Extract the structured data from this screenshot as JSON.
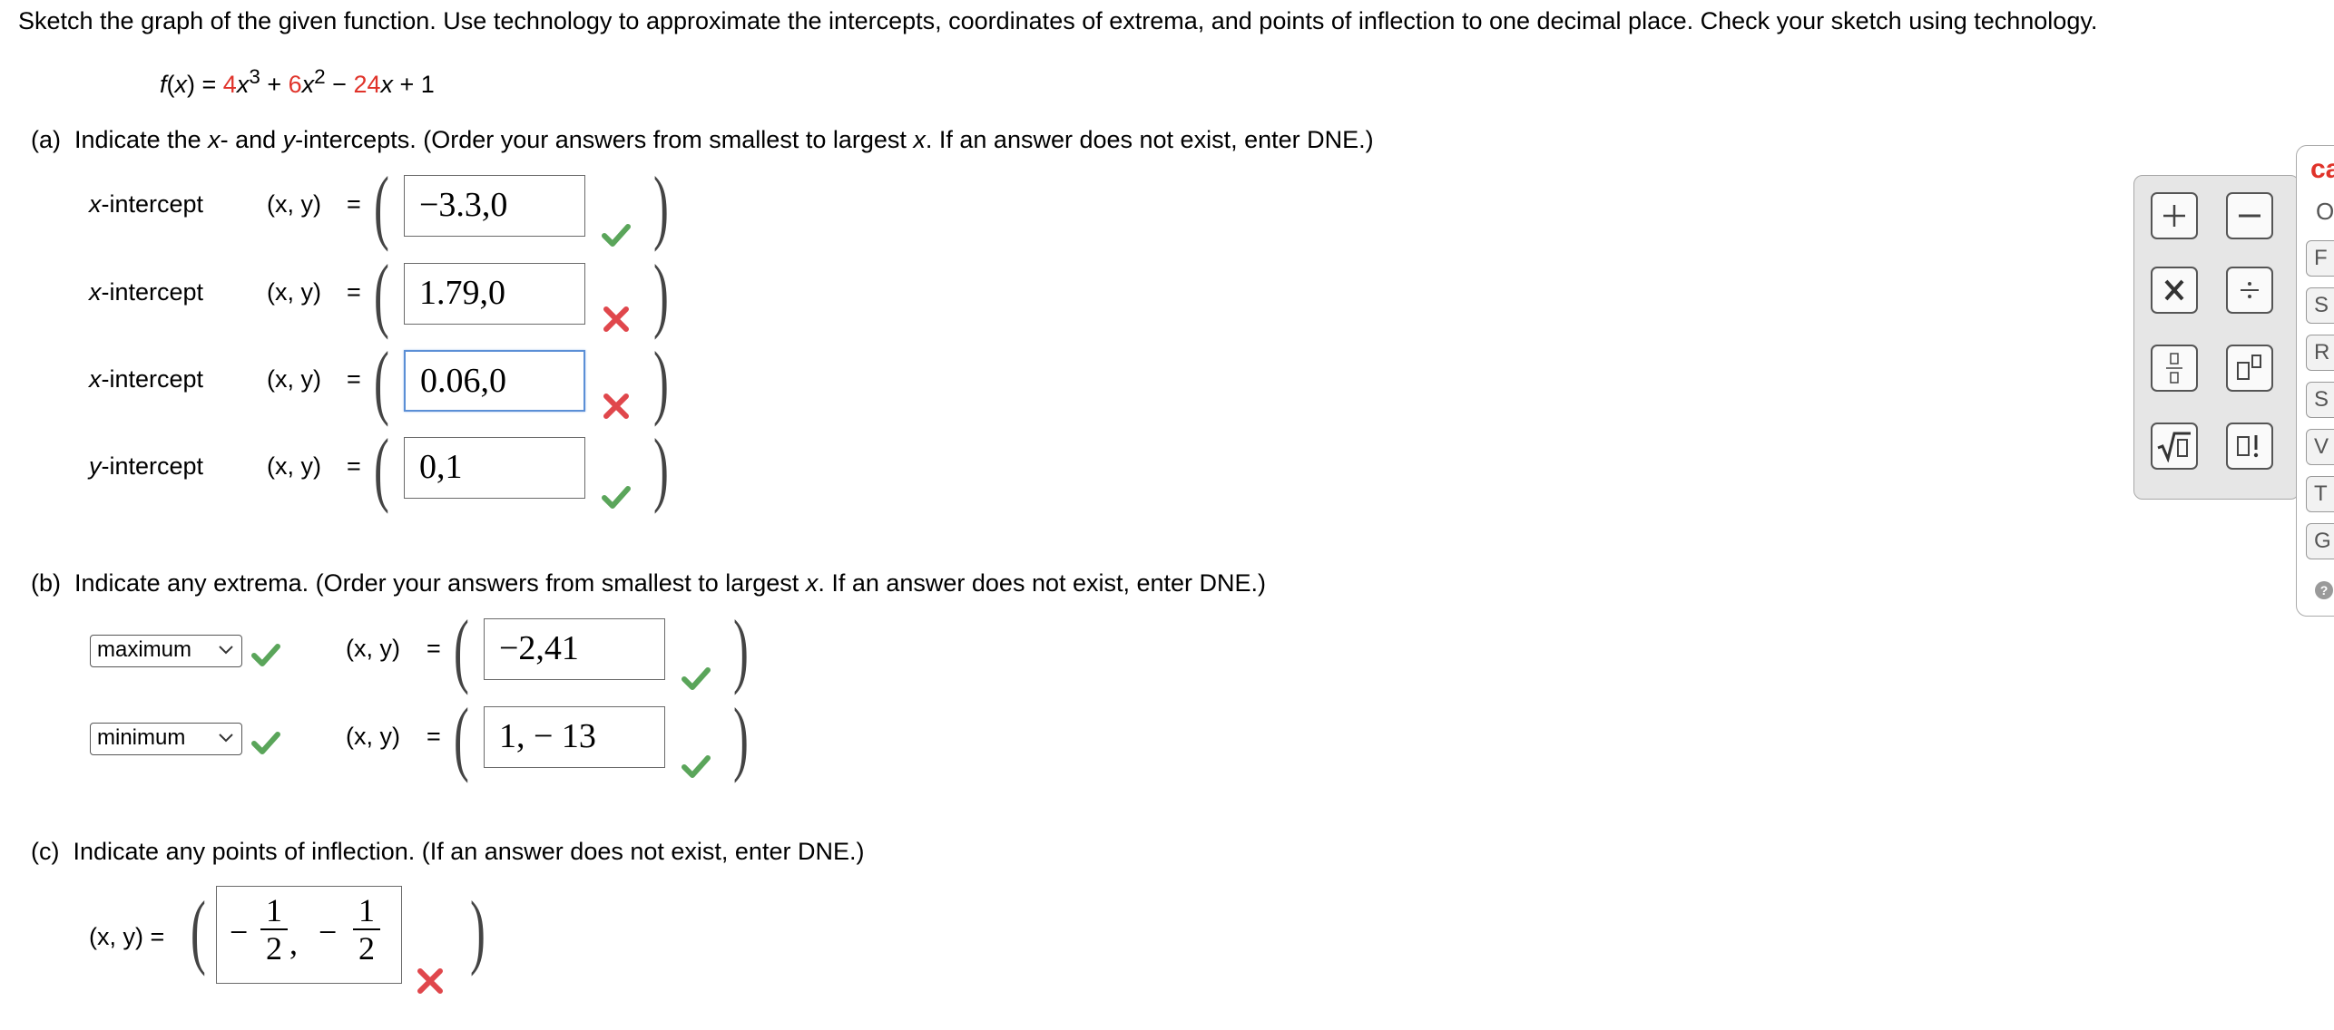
{
  "instructions": "Sketch the graph of the given function. Use technology to approximate the intercepts, coordinates of extrema, and points of inflection to one decimal place. Check your sketch using technology.",
  "function": {
    "lhs": "f(x) = ",
    "c1": "4",
    "t1": "x",
    "e1": "3",
    "op1": " + ",
    "c2": "6",
    "t2": "x",
    "e2": "2",
    "op2": " − ",
    "c3": "24",
    "t3": "x",
    "tail": " + 1"
  },
  "part_a": {
    "label": "(a)",
    "prompt_1": "Indicate the ",
    "prompt_x": "x",
    "prompt_2": "- and ",
    "prompt_y": "y",
    "prompt_3": "-intercepts. (Order your answers from smallest to largest ",
    "prompt_x2": "x",
    "prompt_4": ". If an answer does not exist, enter DNE.)",
    "rows": [
      {
        "var": "x",
        "suffix": "-intercept",
        "xy": "(x, y)",
        "eq": "=",
        "answer": "−3.3,0",
        "status": "correct"
      },
      {
        "var": "x",
        "suffix": "-intercept",
        "xy": "(x, y)",
        "eq": "=",
        "answer": "1.79,0",
        "status": "incorrect"
      },
      {
        "var": "x",
        "suffix": "-intercept",
        "xy": "(x, y)",
        "eq": "=",
        "answer": "0.06,0",
        "status": "incorrect"
      },
      {
        "var": "y",
        "suffix": "-intercept",
        "xy": "(x, y)",
        "eq": "=",
        "answer": "0,1",
        "status": "correct"
      }
    ]
  },
  "part_b": {
    "label": "(b)",
    "prompt_1": "Indicate any extrema. (Order your answers from smallest to largest ",
    "prompt_x": "x",
    "prompt_2": ". If an answer does not exist, enter DNE.)",
    "rows": [
      {
        "select": "maximum",
        "xy": "(x, y)",
        "eq": "=",
        "answer": "−2,41",
        "status": "correct"
      },
      {
        "select": "minimum",
        "xy": "(x, y)",
        "eq": "=",
        "answer": "1, − 13",
        "status": "correct"
      }
    ]
  },
  "part_c": {
    "label": "(c)",
    "prompt": "Indicate any points of inflection. (If an answer does not exist, enter DNE.)",
    "xy": "(x, y) =",
    "answer": {
      "neg1": "−",
      "num1": "1",
      "den1": "2",
      "comma": ",",
      "neg2": "−",
      "num2": "1",
      "den2": "2"
    },
    "status": "incorrect"
  },
  "keypad": {
    "keys": [
      "+",
      "−",
      "X",
      "÷",
      "fraction-template",
      "power-template",
      "sqrt-template",
      "factorial-template"
    ],
    "colors": {
      "panel": "#e6e6e6",
      "border": "#555555"
    }
  },
  "side_panel": {
    "title": "ca",
    "tabs": [
      "O",
      "F",
      "S",
      "R",
      "S",
      "V",
      "T",
      "G"
    ]
  },
  "colors": {
    "red": "#e0332a",
    "check": "#5aa55a",
    "cross": "#e0474c",
    "focus": "#5b8fd6"
  }
}
